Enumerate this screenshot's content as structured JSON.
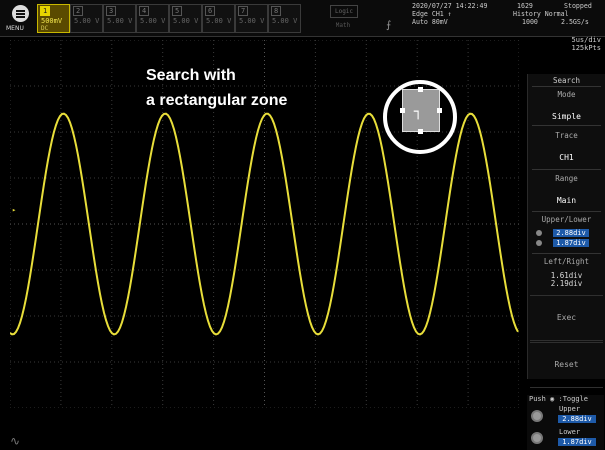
{
  "menu": {
    "label": "MENU",
    "icon": "menu-icon"
  },
  "channels": [
    {
      "num": "1",
      "value": "500mV",
      "sub": "DC",
      "active": true
    },
    {
      "num": "2",
      "value": "5.00 V",
      "sub": "",
      "active": false
    },
    {
      "num": "3",
      "value": "5.00 V",
      "sub": "",
      "active": false
    },
    {
      "num": "4",
      "value": "5.00 V",
      "sub": "",
      "active": false
    },
    {
      "num": "5",
      "value": "5.00 V",
      "sub": "",
      "active": false
    },
    {
      "num": "6",
      "value": "5.00 V",
      "sub": "",
      "active": false
    },
    {
      "num": "7",
      "value": "5.00 V",
      "sub": "",
      "active": false
    },
    {
      "num": "8",
      "value": "5.00 V",
      "sub": "",
      "active": false
    }
  ],
  "logic_label": "Logic",
  "math_label": "Math",
  "status": {
    "datetime": "2020/07/27 14:22:49",
    "count": "1629",
    "state": "Stopped",
    "trigger": "Edge CH1 ↑",
    "history": "History Normal",
    "level": "Auto 80mV",
    "history_count": "1000",
    "sample_rate": "2.5GS/s"
  },
  "timebase": {
    "time_div": "5us/div",
    "points": "125kPts"
  },
  "annotation": {
    "line1": "Search with",
    "line2": "a rectangular zone"
  },
  "side_menu": {
    "title": "Search",
    "mode_label": "Mode",
    "mode_value": "Simple",
    "trace_label": "Trace",
    "trace_value": "CH1",
    "range_label": "Range",
    "range_value": "Main",
    "upper_lower_label": "Upper/Lower",
    "upper_value": "2.88div",
    "lower_value": "1.87div",
    "left_right_label": "Left/Right",
    "left_value": "1.61div",
    "right_value": "2.19div",
    "exec_label": "Exec",
    "reset_label": "Reset"
  },
  "push_panel": {
    "push_label": "Push ◉ :Toggle",
    "upper_label": "Upper",
    "upper_value": "2.88div",
    "lower_label": "Lower",
    "lower_value": "1.87div"
  },
  "colors": {
    "trace": "#e8de3a",
    "accent": "#1e5aa8",
    "grid": "#3a3a3a"
  },
  "waveform": {
    "cycles_visible": 5.0,
    "amplitude_div": 2.4
  }
}
